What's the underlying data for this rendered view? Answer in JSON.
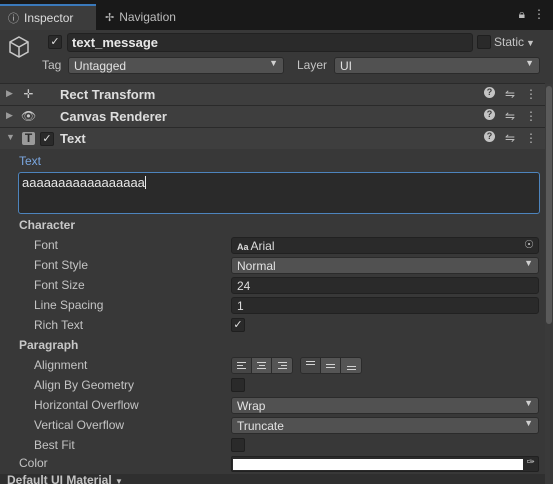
{
  "tabs": [
    {
      "label": "Inspector",
      "icon": "info-icon"
    },
    {
      "label": "Navigation",
      "icon": "navigation-icon"
    }
  ],
  "gameobject": {
    "active": true,
    "name": "text_message",
    "static_label": "Static",
    "static": false,
    "tag_label": "Tag",
    "tag_value": "Untagged",
    "layer_label": "Layer",
    "layer_value": "UI"
  },
  "components": [
    {
      "title": "Rect Transform",
      "icon": "rect-transform-icon",
      "expanded": false
    },
    {
      "title": "Canvas Renderer",
      "icon": "eye-icon",
      "expanded": false
    },
    {
      "title": "Text",
      "icon": "text-component-icon",
      "expanded": true,
      "enabled": true
    }
  ],
  "text_component": {
    "text_label": "Text",
    "text_value": "aaaaaaaaaaaaaaaaa",
    "character_header": "Character",
    "font_label": "Font",
    "font_value": "Arial",
    "font_icon_glyph": "Aa",
    "font_style_label": "Font Style",
    "font_style_value": "Normal",
    "font_size_label": "Font Size",
    "font_size_value": "24",
    "line_spacing_label": "Line Spacing",
    "line_spacing_value": "1",
    "rich_text_label": "Rich Text",
    "rich_text": true,
    "paragraph_header": "Paragraph",
    "alignment_label": "Alignment",
    "align_by_geometry_label": "Align By Geometry",
    "align_by_geometry": false,
    "horizontal_overflow_label": "Horizontal Overflow",
    "horizontal_overflow_value": "Wrap",
    "vertical_overflow_label": "Vertical Overflow",
    "vertical_overflow_value": "Truncate",
    "best_fit_label": "Best Fit",
    "best_fit": false,
    "color_label": "Color",
    "color_value": "#ffffff"
  },
  "material_label": "Default UI Material",
  "colors": {
    "background": "#383838",
    "tabbar": "#191919",
    "accent": "#3a79bb",
    "field": "#2a2a2a",
    "dropdown": "#515151",
    "label_blue": "#7ba7e0"
  }
}
